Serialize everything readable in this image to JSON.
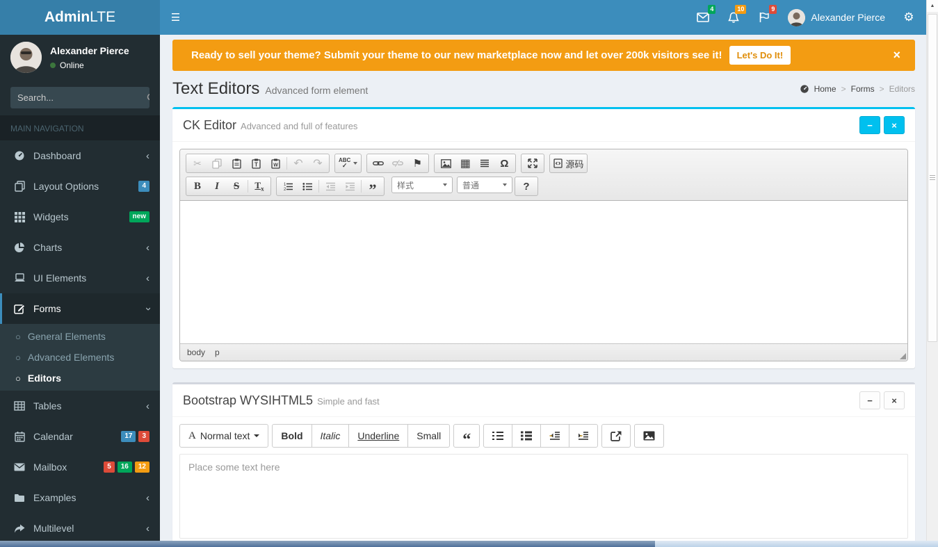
{
  "logo": {
    "bold": "Admin",
    "light": "LTE"
  },
  "header": {
    "user_name": "Alexander Pierce",
    "badges": {
      "messages": "4",
      "notifications": "10",
      "tasks": "9"
    }
  },
  "sidebar": {
    "user": {
      "name": "Alexander Pierce",
      "status": "Online"
    },
    "search_placeholder": "Search...",
    "section_label": "MAIN NAVIGATION",
    "items": [
      {
        "label": "Dashboard"
      },
      {
        "label": "Layout Options"
      },
      {
        "label": "Widgets"
      },
      {
        "label": "Charts"
      },
      {
        "label": "UI Elements"
      },
      {
        "label": "Forms"
      },
      {
        "label": "Tables"
      },
      {
        "label": "Calendar"
      },
      {
        "label": "Mailbox"
      },
      {
        "label": "Examples"
      },
      {
        "label": "Multilevel"
      }
    ],
    "badges": {
      "layout_options": "4",
      "widgets": "new",
      "calendar": [
        "17",
        "3"
      ],
      "mailbox": [
        "5",
        "16",
        "12"
      ]
    },
    "forms_submenu": [
      "General Elements",
      "Advanced Elements",
      "Editors"
    ]
  },
  "banner": {
    "text": "Ready to sell your theme? Submit your theme to our new marketplace now and let over 200k visitors see it!",
    "button_label": "Let's Do It!"
  },
  "page_header": {
    "title": "Text Editors",
    "subtitle": "Advanced form element",
    "breadcrumb": [
      "Home",
      "Forms",
      "Editors"
    ]
  },
  "ckeditor": {
    "title": "CK Editor",
    "subtitle": "Advanced and full of features",
    "toolbar": {
      "spellcheck": "ABC",
      "check": "✓",
      "bold": "B",
      "italic": "I",
      "strike": "S",
      "removeformat_t": "T",
      "removeformat_x": "x",
      "styles": "样式",
      "format": "普通",
      "source": "源码",
      "help": "?"
    },
    "path": [
      "body",
      "p"
    ]
  },
  "wysihtml5": {
    "title": "Bootstrap WYSIHTML5",
    "subtitle": "Simple and fast",
    "toolbar": {
      "font": "Normal text",
      "font_a": "A",
      "bold": "Bold",
      "italic": "Italic",
      "underline": "Underline",
      "small": "Small"
    },
    "placeholder": "Place some text here"
  },
  "icons": {
    "hamburger": "☰",
    "gear": "⚙",
    "scissors": "✂",
    "undo": "↶",
    "redo": "↷",
    "flag": "⚑",
    "table": "▦",
    "omega": "Ω",
    "quote_close": "”",
    "quote_open": "“",
    "minus": "−",
    "close": "×",
    "circle": "○",
    "chevron": "‹",
    "up_arrow": "▲"
  },
  "colors": {
    "navbar": "#3c8dbc",
    "sidebar": "#222d32",
    "banner": "#f39c12",
    "info": "#00c0ef",
    "green": "#00a65a",
    "yellow": "#f39c12",
    "red": "#dd4b39",
    "blue": "#3c8dbc"
  }
}
